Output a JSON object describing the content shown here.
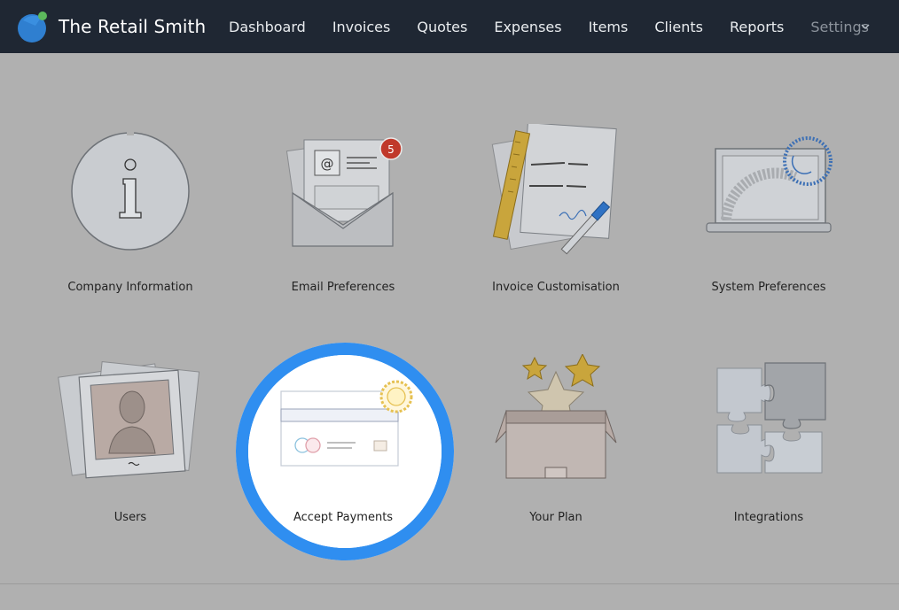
{
  "app": {
    "name": "The Retail Smith",
    "logo_icon": "globe-logo-icon",
    "colors": {
      "nav_bg": "#1f2733",
      "accent": "#2f8ef0",
      "overlay": "#b0b0b0"
    }
  },
  "nav": {
    "items": [
      {
        "label": "Dashboard"
      },
      {
        "label": "Invoices"
      },
      {
        "label": "Quotes"
      },
      {
        "label": "Expenses"
      },
      {
        "label": "Items"
      },
      {
        "label": "Clients"
      },
      {
        "label": "Reports"
      },
      {
        "label": "Settings",
        "active": true
      }
    ],
    "menu_icon": "chevron-down-icon"
  },
  "settings": {
    "tiles": [
      {
        "label": "Company Information",
        "icon": "info-icon"
      },
      {
        "label": "Email Preferences",
        "icon": "envelope-icon",
        "badge": "5"
      },
      {
        "label": "Invoice Customisation",
        "icon": "invoice-ruler-pen-icon"
      },
      {
        "label": "System Preferences",
        "icon": "laptop-gears-icon"
      },
      {
        "label": "Users",
        "icon": "user-photos-icon"
      },
      {
        "label": "Accept Payments",
        "icon": "credit-card-gear-icon",
        "highlighted": true
      },
      {
        "label": "Your Plan",
        "icon": "box-stars-icon"
      },
      {
        "label": "Integrations",
        "icon": "puzzle-icon"
      }
    ]
  }
}
